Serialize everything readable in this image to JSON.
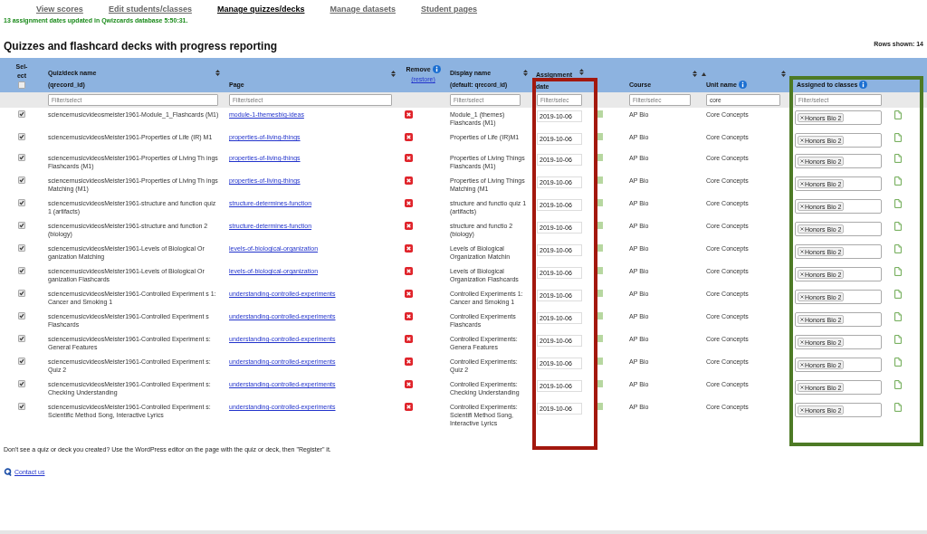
{
  "nav": [
    {
      "label": "View scores",
      "selected": false
    },
    {
      "label": "Edit students/classes",
      "selected": false
    },
    {
      "label": "Manage quizzes/decks",
      "selected": true
    },
    {
      "label": "Manage datasets",
      "selected": false
    },
    {
      "label": "Student pages",
      "selected": false
    }
  ],
  "message": "13 assignment dates updated in Qwizcards database 5:50:31.",
  "title": "Quizzes and flashcard decks with progress reporting",
  "rows_shown": "Rows shown: 14",
  "header": {
    "select": {
      "label": "Sel-ect",
      "checked": false
    },
    "quiz_name": {
      "label": "Quiz/deck name",
      "sub": "(qrecord_id)"
    },
    "page": {
      "label": "Page"
    },
    "remove": {
      "label": "Remove",
      "link": "(restore)"
    },
    "display_name": {
      "label": "Display name",
      "sub": "(default: qrecord_id)"
    },
    "date": {
      "label": "Assignment date"
    },
    "course": {
      "label": "Course"
    },
    "unit": {
      "label": "Unit name"
    },
    "classes": {
      "label": "Assigned to classes"
    }
  },
  "filters": [
    {
      "placeholder": "Filter/select"
    },
    {
      "placeholder": "Filter/select"
    },
    {
      "placeholder": "Filter/select"
    },
    {
      "placeholder": "Filter/selec"
    },
    {
      "placeholder": "Filter/selec"
    },
    {
      "value": "core"
    },
    {
      "placeholder": "Filter/select"
    }
  ],
  "rows": [
    {
      "checked": true,
      "quiz_name": "sciencemusicvideosmeister1961-Module_1_Flashcards (M1)",
      "page": "module-1-themesbig-ideas",
      "display_name": "Module_1 (themes) Flashcards (M1)",
      "date": "2019-10-06",
      "course": "AP Bio",
      "unit": "Core Concepts",
      "classes": [
        "Honors Bio 2"
      ]
    },
    {
      "checked": true,
      "quiz_name": "sciencemusicvideosMeister1961-Properties of Life (IR) M1",
      "page": "properties-of-living-things",
      "display_name": "Properties of Life (IR)M1",
      "date": "2019-10-06",
      "course": "AP Bio",
      "unit": "Core Concepts",
      "classes": [
        "Honors Bio 2"
      ]
    },
    {
      "checked": true,
      "quiz_name": "sciencemusicvideosMeister1961-Properties of Living Th ings Flashcards (M1)",
      "page": "properties-of-living-things",
      "display_name": "Properties of Living Things Flashcards (M1)",
      "date": "2019-10-06",
      "course": "AP Bio",
      "unit": "Core Concepts",
      "classes": [
        "Honors Bio 2"
      ]
    },
    {
      "checked": true,
      "quiz_name": "sciencemusicvideosMeister1961-Properties of Living Th ings Matching (M1)",
      "page": "properties-of-living-things",
      "display_name": "Properties of Living Things Matching (M1",
      "date": "2019-10-06",
      "course": "AP Bio",
      "unit": "Core Concepts",
      "classes": [
        "Honors Bio 2"
      ]
    },
    {
      "checked": true,
      "quiz_name": "sciencemusicvideosMeister1961-structure and function quiz 1 (artifacts)",
      "page": "structure-determines-function",
      "display_name": "structure and functio quiz 1 (artifacts)",
      "date": "2019-10-06",
      "course": "AP Bio",
      "unit": "Core Concepts",
      "classes": [
        "Honors Bio 2"
      ]
    },
    {
      "checked": true,
      "quiz_name": "sciencemusicvideosMeister1961-structure and function 2 (biology)",
      "page": "structure-determines-function",
      "display_name": "structure and functio 2 (biology)",
      "date": "2019-10-06",
      "course": "AP Bio",
      "unit": "Core Concepts",
      "classes": [
        "Honors Bio 2"
      ]
    },
    {
      "checked": true,
      "quiz_name": "sciencemusicvideosMeister1961-Levels of Biological Or ganization Matching",
      "page": "levels-of-biological-organization",
      "display_name": "Levels of Biological Organization Matchin",
      "date": "2019-10-06",
      "course": "AP Bio",
      "unit": "Core Concepts",
      "classes": [
        "Honors Bio 2"
      ]
    },
    {
      "checked": true,
      "quiz_name": "sciencemusicvideosMeister1961-Levels of Biological Or ganization Flashcards",
      "page": "levels-of-biological-organization",
      "display_name": "Levels of Biological Organization Flashcards",
      "date": "2019-10-06",
      "course": "AP Bio",
      "unit": "Core Concepts",
      "classes": [
        "Honors Bio 2"
      ]
    },
    {
      "checked": true,
      "quiz_name": "sciencemusicvideosMeister1961-Controlled Experiment s 1: Cancer and Smoking 1",
      "page": "understanding-controlled-experiments",
      "display_name": "Controlled Experiments 1: Cancer and Smoking 1",
      "date": "2019-10-06",
      "course": "AP Bio",
      "unit": "Core Concepts",
      "classes": [
        "Honors Bio 2"
      ]
    },
    {
      "checked": true,
      "quiz_name": "sciencemusicvideosMeister1961-Controlled Experiment s Flashcards",
      "page": "understanding-controlled-experiments",
      "display_name": "Controlled Experiments Flashcards",
      "date": "2019-10-06",
      "course": "AP Bio",
      "unit": "Core Concepts",
      "classes": [
        "Honors Bio 2"
      ]
    },
    {
      "checked": true,
      "quiz_name": "sciencemusicvideosMeister1961-Controlled Experiment s: General Features",
      "page": "understanding-controlled-experiments",
      "display_name": "Controlled Experiments: Genera Features",
      "date": "2019-10-06",
      "course": "AP Bio",
      "unit": "Core Concepts",
      "classes": [
        "Honors Bio 2"
      ]
    },
    {
      "checked": true,
      "quiz_name": "sciencemusicvideosMeister1961-Controlled Experiment s: Quiz 2",
      "page": "understanding-controlled-experiments",
      "display_name": "Controlled Experiments: Quiz 2",
      "date": "2019-10-06",
      "course": "AP Bio",
      "unit": "Core Concepts",
      "classes": [
        "Honors Bio 2"
      ]
    },
    {
      "checked": true,
      "quiz_name": "sciencemusicvideosMeister1961-Controlled Experiment s: Checking Understanding",
      "page": "understanding-controlled-experiments",
      "display_name": "Controlled Experiments: Checking Understanding",
      "date": "2019-10-06",
      "course": "AP Bio",
      "unit": "Core Concepts",
      "classes": [
        "Honors Bio 2"
      ]
    },
    {
      "checked": true,
      "quiz_name": "sciencemusicvideosMeister1961-Controlled Experiment s: Scientific Method Song, Interactive Lyrics",
      "page": "understanding-controlled-experiments",
      "display_name": "Controlled Experiments: Scientifi Method Song, Interactive Lyrics",
      "date": "2019-10-06",
      "course": "AP Bio",
      "unit": "Core Concepts",
      "classes": [
        "Honors Bio 2"
      ]
    }
  ],
  "note": "Don't see a quiz or deck you created?  Use the WordPress editor on the page with the quiz or deck, then \"Register\" it.",
  "contact": "Contact us",
  "highlight_frames": [
    {
      "color": "#a3180e"
    },
    {
      "color": "#4d7a25"
    }
  ]
}
